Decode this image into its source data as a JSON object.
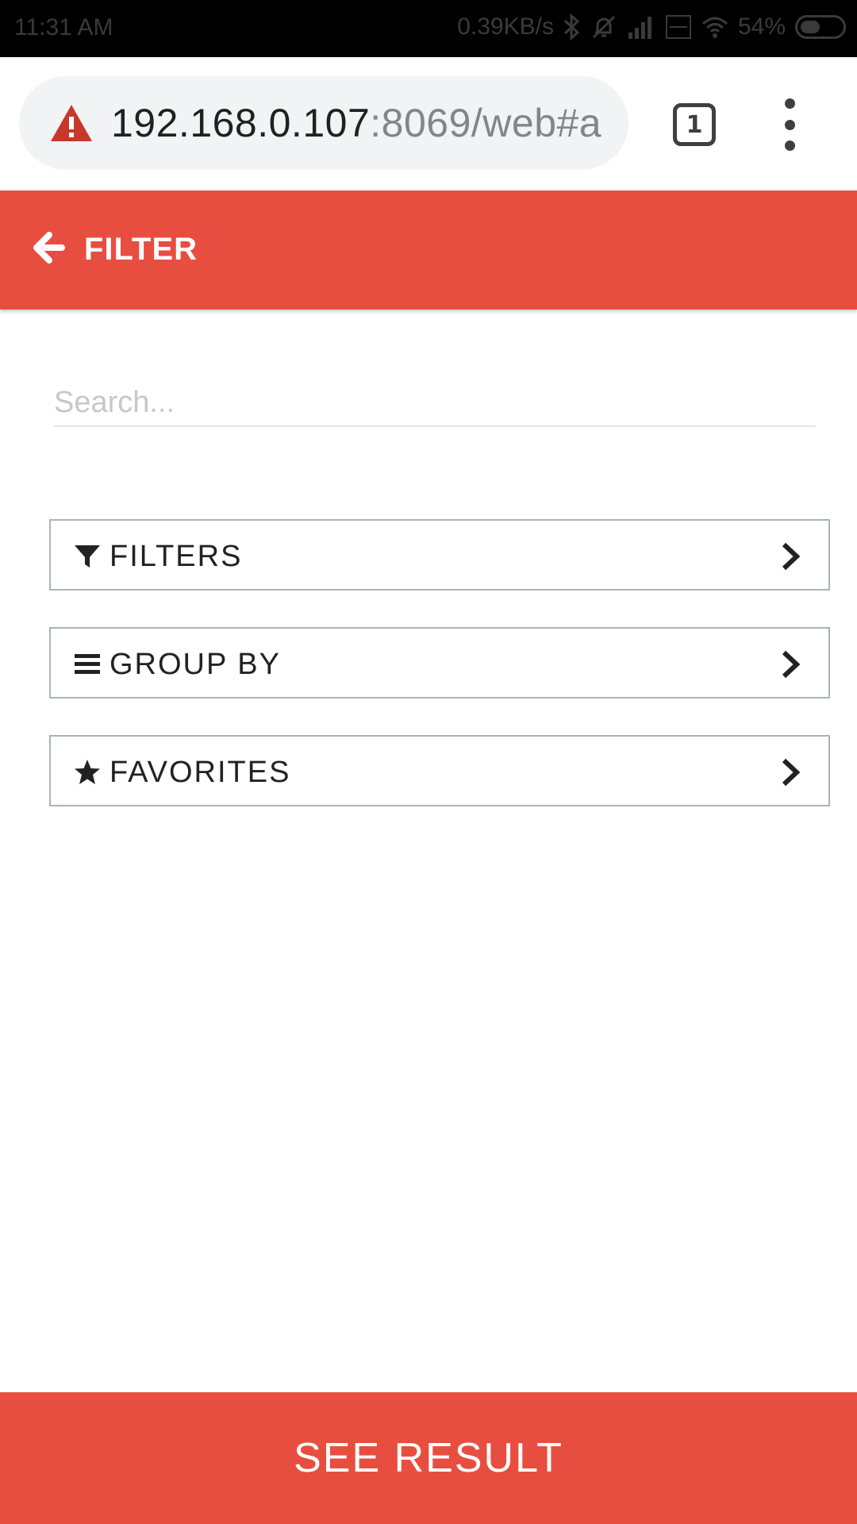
{
  "status_bar": {
    "time": "11:31 AM",
    "net_speed": "0.39KB/s",
    "battery": "54%",
    "icons": [
      "bluetooth-icon",
      "mute-icon",
      "signal-icon",
      "volte-icon",
      "wifi-icon",
      "battery-icon"
    ]
  },
  "browser": {
    "url_host": "192.168.0.107",
    "url_rest": ":8069/web#a",
    "tab_count": "1",
    "icons": {
      "security": "warning-icon",
      "menu": "more-vert-icon"
    }
  },
  "header": {
    "title": "FILTER",
    "back_icon": "arrow-left-icon"
  },
  "search": {
    "placeholder": "Search...",
    "value": ""
  },
  "options": [
    {
      "label": "FILTERS",
      "icon": "filter-icon"
    },
    {
      "label": "GROUP BY",
      "icon": "bars-icon"
    },
    {
      "label": "FAVORITES",
      "icon": "star-icon"
    }
  ],
  "footer": {
    "button_label": "SEE RESULT"
  },
  "colors": {
    "accent": "#e84e3f",
    "option_border": "#a9b3bc",
    "url_bg": "#f1f3f4"
  }
}
